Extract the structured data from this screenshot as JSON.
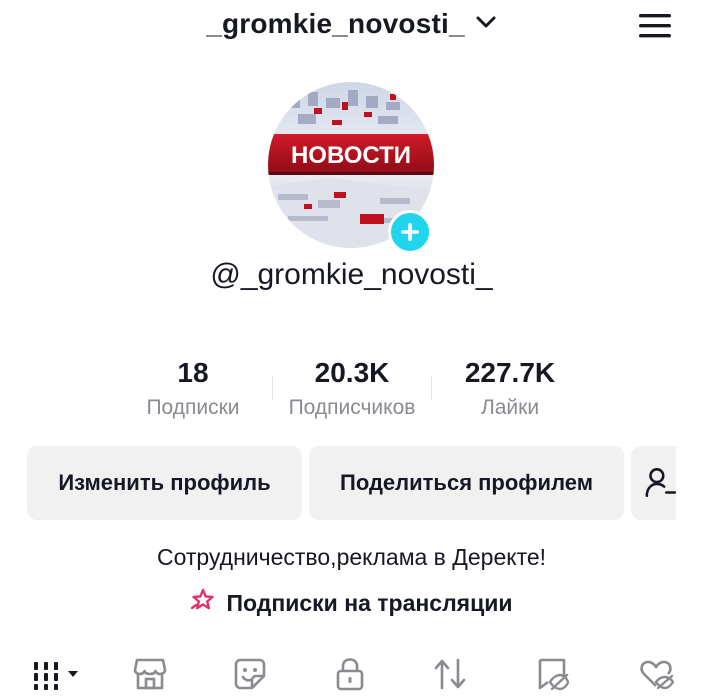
{
  "header": {
    "username": "_gromkie_novosti_",
    "switch_icon": "chevron-down-icon",
    "menu_icon": "hamburger-menu-icon"
  },
  "avatar": {
    "logo_text": "НОВОСТИ",
    "add_icon": "plus-icon",
    "accent": "#20d5ec"
  },
  "profile": {
    "handle": "@_gromkie_novosti_"
  },
  "stats": [
    {
      "value": "18",
      "label": "Подписки"
    },
    {
      "value": "20.3K",
      "label": "Подписчиков"
    },
    {
      "value": "227.7K",
      "label": "Лайки"
    }
  ],
  "actions": {
    "edit_label": "Изменить профиль",
    "share_label": "Поделиться профилем",
    "add_friend_icon": "add-friend-icon"
  },
  "bio": {
    "text": "Сотрудничество,реклама в Деректе!"
  },
  "subscriptions": {
    "label": "Подписки на трансляции",
    "icon": "sparkle-star-icon",
    "icon_color": "#e6306f"
  },
  "tabs": [
    {
      "icon": "videos-grid-icon",
      "selected": true
    },
    {
      "icon": "shop-icon"
    },
    {
      "icon": "sticker-icon"
    },
    {
      "icon": "lock-icon"
    },
    {
      "icon": "repost-icon"
    },
    {
      "icon": "favorites-icon"
    },
    {
      "icon": "liked-hidden-icon"
    }
  ]
}
